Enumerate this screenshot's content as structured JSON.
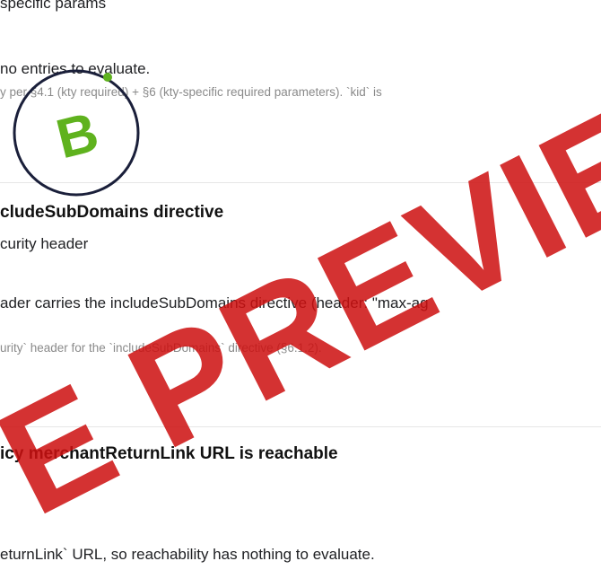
{
  "checks": [
    {
      "subtitle": "specific params",
      "result": "no entries to evaluate.",
      "note": "y per §4.1 (kty required) + §6 (kty-specific required parameters). `kid` is"
    },
    {
      "title": "cludeSubDomains directive",
      "subtitle": "curity header",
      "result": "ader carries the includeSubDomains directive (header: \"max-ag",
      "note": "urity` header for the `includeSubDomains` directive (§6.1.2)."
    },
    {
      "title": "icy merchantReturnLink URL is reachable",
      "result": "eturnLink` URL, so reachability has nothing to evaluate."
    }
  ],
  "watermark": {
    "text": "E PREVIEW",
    "badge_letter": "B",
    "color": "#cc1111",
    "badge_letter_color": "#5fb21e",
    "badge_ring_color": "#1a1f3a"
  }
}
